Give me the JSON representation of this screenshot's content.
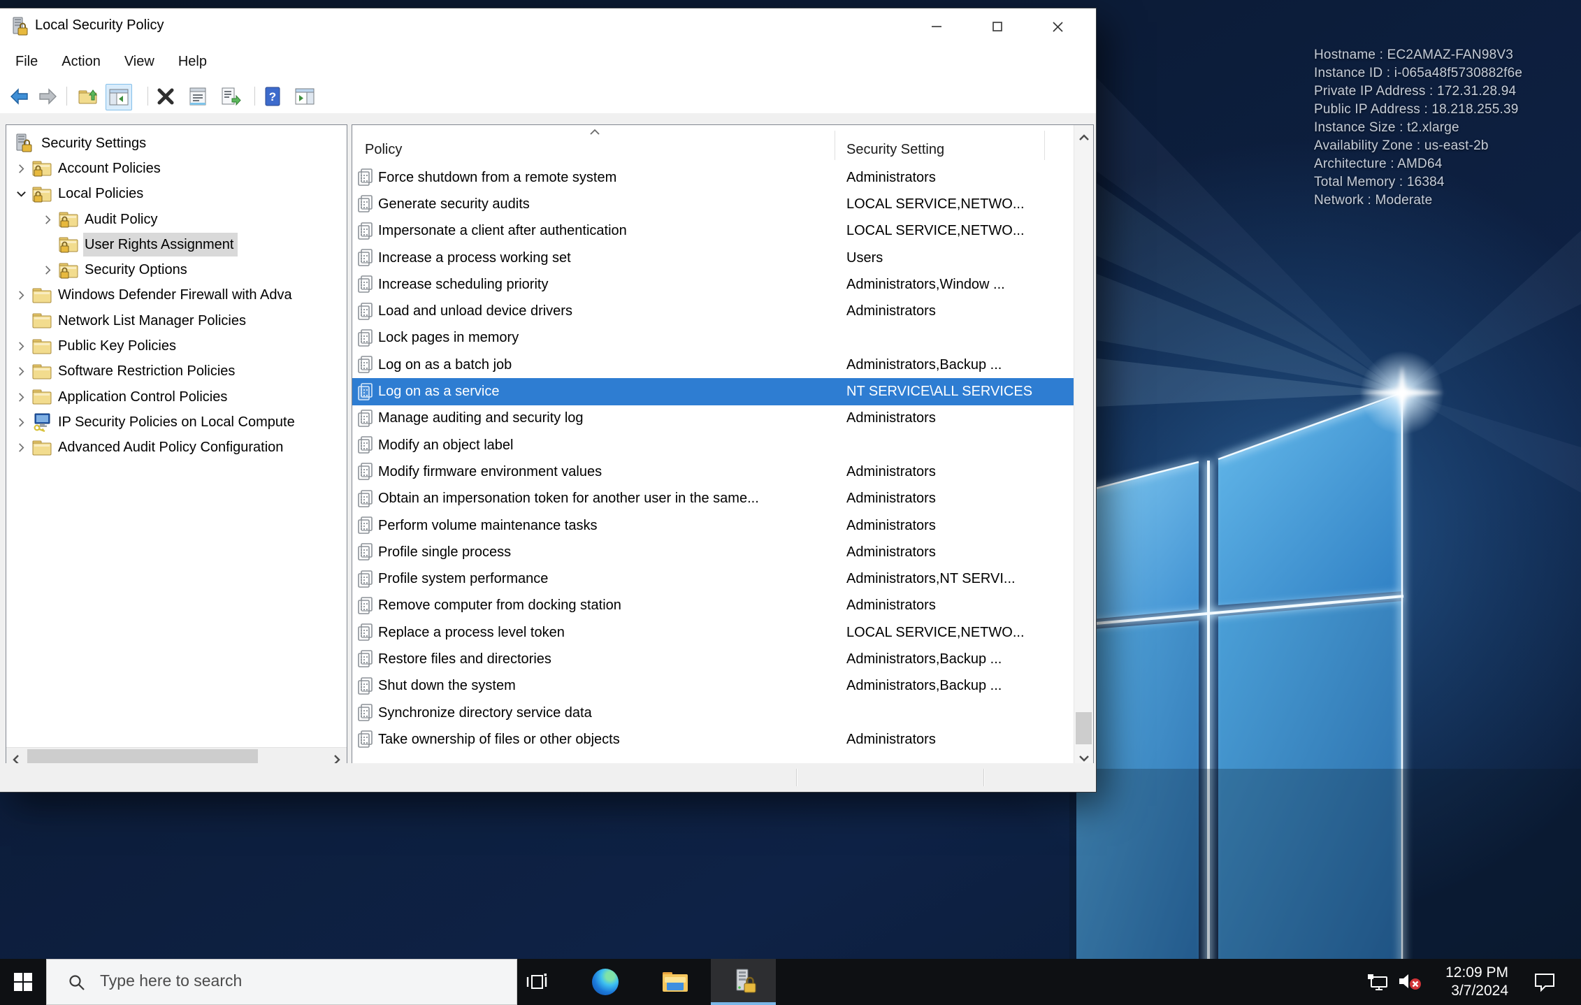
{
  "colors": {
    "selection_blue": "#2e7dd2",
    "tree_selection_gray": "#d9d9d9",
    "active_app_underline": "#7ab7e8",
    "mute_badge_red": "#d13438",
    "wallpaper_navy": "#0c1c38"
  },
  "window": {
    "title": "Local Security Policy",
    "menu": {
      "items": [
        "File",
        "Action",
        "View",
        "Help"
      ]
    },
    "toolbar": {
      "buttons": [
        "back",
        "forward",
        "up-level",
        "show-hide-console-tree",
        "delete",
        "properties",
        "export-list",
        "help",
        "show-action-pane"
      ],
      "active_button": "show-hide-console-tree"
    },
    "tree": {
      "items": [
        {
          "label": "Security Settings",
          "level": 0,
          "root": true,
          "icon": "root",
          "expander": "none"
        },
        {
          "label": "Account Policies",
          "level": 1,
          "icon": "folder-lock",
          "expander": "collapsed"
        },
        {
          "label": "Local Policies",
          "level": 1,
          "icon": "folder-lock",
          "expander": "expanded"
        },
        {
          "label": "Audit Policy",
          "level": 2,
          "icon": "folder-lock",
          "expander": "collapsed"
        },
        {
          "label": "User Rights Assignment",
          "level": 2,
          "icon": "folder-lock",
          "expander": "none",
          "selected": true
        },
        {
          "label": "Security Options",
          "level": 2,
          "icon": "folder-lock",
          "expander": "collapsed"
        },
        {
          "label": "Windows Defender Firewall with Adva",
          "level": 1,
          "icon": "folder",
          "expander": "collapsed"
        },
        {
          "label": "Network List Manager Policies",
          "level": 1,
          "icon": "folder",
          "expander": "none"
        },
        {
          "label": "Public Key Policies",
          "level": 1,
          "icon": "folder",
          "expander": "collapsed"
        },
        {
          "label": "Software Restriction Policies",
          "level": 1,
          "icon": "folder",
          "expander": "collapsed"
        },
        {
          "label": "Application Control Policies",
          "level": 1,
          "icon": "folder",
          "expander": "collapsed"
        },
        {
          "label": "IP Security Policies on Local Compute",
          "level": 1,
          "icon": "ipsec",
          "expander": "collapsed"
        },
        {
          "label": "Advanced Audit Policy Configuration",
          "level": 1,
          "icon": "folder",
          "expander": "collapsed"
        }
      ]
    },
    "list": {
      "columns": [
        "Policy",
        "Security Setting"
      ],
      "rows": [
        {
          "policy": "Force shutdown from a remote system",
          "setting": "Administrators"
        },
        {
          "policy": "Generate security audits",
          "setting": "LOCAL SERVICE,NETWO..."
        },
        {
          "policy": "Impersonate a client after authentication",
          "setting": "LOCAL SERVICE,NETWO..."
        },
        {
          "policy": "Increase a process working set",
          "setting": "Users"
        },
        {
          "policy": "Increase scheduling priority",
          "setting": "Administrators,Window ..."
        },
        {
          "policy": "Load and unload device drivers",
          "setting": "Administrators"
        },
        {
          "policy": "Lock pages in memory",
          "setting": ""
        },
        {
          "policy": "Log on as a batch job",
          "setting": "Administrators,Backup ..."
        },
        {
          "policy": "Log on as a service",
          "setting": "NT SERVICE\\ALL SERVICES",
          "selected": true
        },
        {
          "policy": "Manage auditing and security log",
          "setting": "Administrators"
        },
        {
          "policy": "Modify an object label",
          "setting": ""
        },
        {
          "policy": "Modify firmware environment values",
          "setting": "Administrators"
        },
        {
          "policy": "Obtain an impersonation token for another user in the same...",
          "setting": "Administrators"
        },
        {
          "policy": "Perform volume maintenance tasks",
          "setting": "Administrators"
        },
        {
          "policy": "Profile single process",
          "setting": "Administrators"
        },
        {
          "policy": "Profile system performance",
          "setting": "Administrators,NT SERVI..."
        },
        {
          "policy": "Remove computer from docking station",
          "setting": "Administrators"
        },
        {
          "policy": "Replace a process level token",
          "setting": "LOCAL SERVICE,NETWO..."
        },
        {
          "policy": "Restore files and directories",
          "setting": "Administrators,Backup ..."
        },
        {
          "policy": "Shut down the system",
          "setting": "Administrators,Backup ..."
        },
        {
          "policy": "Synchronize directory service data",
          "setting": ""
        },
        {
          "policy": "Take ownership of files or other objects",
          "setting": "Administrators"
        }
      ]
    }
  },
  "desktop": {
    "overlay_lines": [
      "Hostname : EC2AMAZ-FAN98V3",
      "Instance ID : i-065a48f5730882f6e",
      "Private IP Address : 172.31.28.94",
      "Public IP Address : 18.218.255.39",
      "Instance Size : t2.xlarge",
      "Availability Zone : us-east-2b",
      "Architecture : AMD64",
      "Total Memory : 16384",
      "Network : Moderate"
    ]
  },
  "taskbar": {
    "search": {
      "placeholder": "Type here to search"
    },
    "apps": [
      "task-view",
      "edge",
      "file-explorer",
      "local-security-policy"
    ],
    "active_app": "local-security-policy",
    "tray": {
      "time": "12:09 PM",
      "date": "3/7/2024"
    }
  }
}
